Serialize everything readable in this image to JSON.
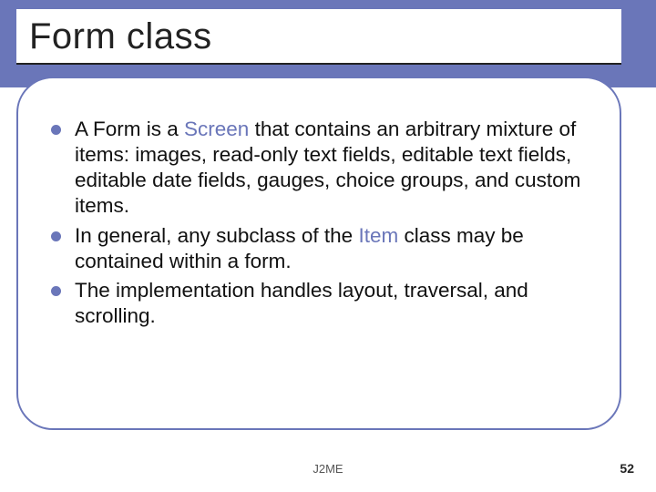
{
  "title": "Form class",
  "bullets": [
    {
      "pre": "A Form is a ",
      "kw": "Screen",
      "post": " that contains an arbitrary mixture of items: images, read-only text fields, editable text fields, editable date fields, gauges, choice groups, and custom items."
    },
    {
      "pre": "In general, any subclass of the ",
      "kw": "Item",
      "post": " class may be contained within a form."
    },
    {
      "pre": "The implementation handles layout, traversal, and scrolling.",
      "kw": "",
      "post": ""
    }
  ],
  "footer": {
    "center": "J2ME",
    "right": "52"
  },
  "colors": {
    "accent": "#6A76B9"
  }
}
